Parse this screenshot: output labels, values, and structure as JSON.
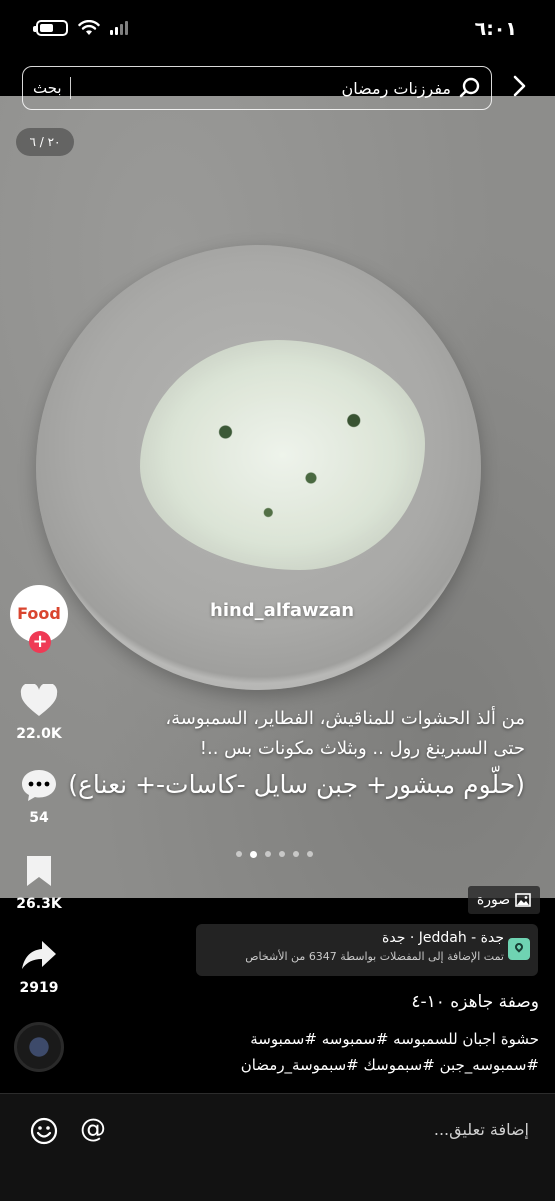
{
  "status_bar": {
    "time": "٦:٠١"
  },
  "search": {
    "query": "مفرزنات رمضان",
    "button": "بحث"
  },
  "photo": {
    "counter": "٢٠ / ٦",
    "watermark": "hind_alfawzan",
    "caption_line1": "من ألذ الحشوات للمناقيش، الفطاير، السمبوسة،",
    "caption_line2": "حتى السبرينغ رول .. وبثلاث مكونات بس ..!",
    "caption_line3": "(حلّوم مبشور+ جبن سايل -كاسات-+ نعناع)",
    "slide_count": 6,
    "active_slide": 1
  },
  "author": {
    "avatar_text": "Food"
  },
  "actions": {
    "likes": "22.0K",
    "comments": "54",
    "saves": "26.3K",
    "shares": "2919"
  },
  "photo_tag": "صورة",
  "location": {
    "title": "جدة - Jeddah · جدة",
    "subtitle": "تمت الإضافة إلى المفضلات بواسطة 6347 من الأشخاص"
  },
  "post": {
    "title": "وصفة جاهزه ١٠-٤",
    "hashtags_line1": "حشوة اجبان للسمبوسه #سمبوسه #سمبوسة",
    "hashtags_line2": "#سمبوسه_جبن #سبموسك #سبموسة_رمضان"
  },
  "comment_bar": {
    "placeholder": "إضافة تعليق..."
  },
  "colors": {
    "background": "#000000",
    "follow_plus": "#ef3a55",
    "location_pin": "#6fd3b2"
  }
}
